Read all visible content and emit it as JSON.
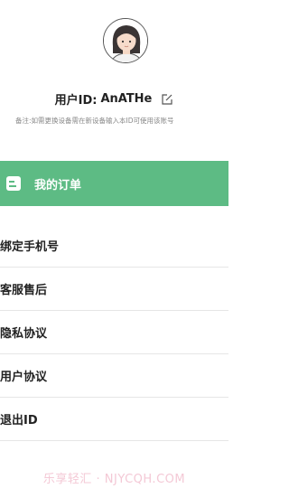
{
  "profile": {
    "avatar_icon": "user-avatar-illustration",
    "user_label": "用户ID:",
    "user_id": "AnATHe",
    "edit_icon": "edit-icon",
    "note": "备注:如需更换设备需在新设备输入本ID可使用该账号"
  },
  "orders": {
    "icon": "document-icon",
    "label": "我的订单",
    "color": "#5dbb84"
  },
  "menu": {
    "items": [
      {
        "label": "绑定手机号"
      },
      {
        "label": "客服售后"
      },
      {
        "label": "隐私协议"
      },
      {
        "label": "用户协议"
      },
      {
        "label": "退出ID"
      }
    ]
  },
  "watermark": "乐享轻汇 · NJYCQH.COM"
}
